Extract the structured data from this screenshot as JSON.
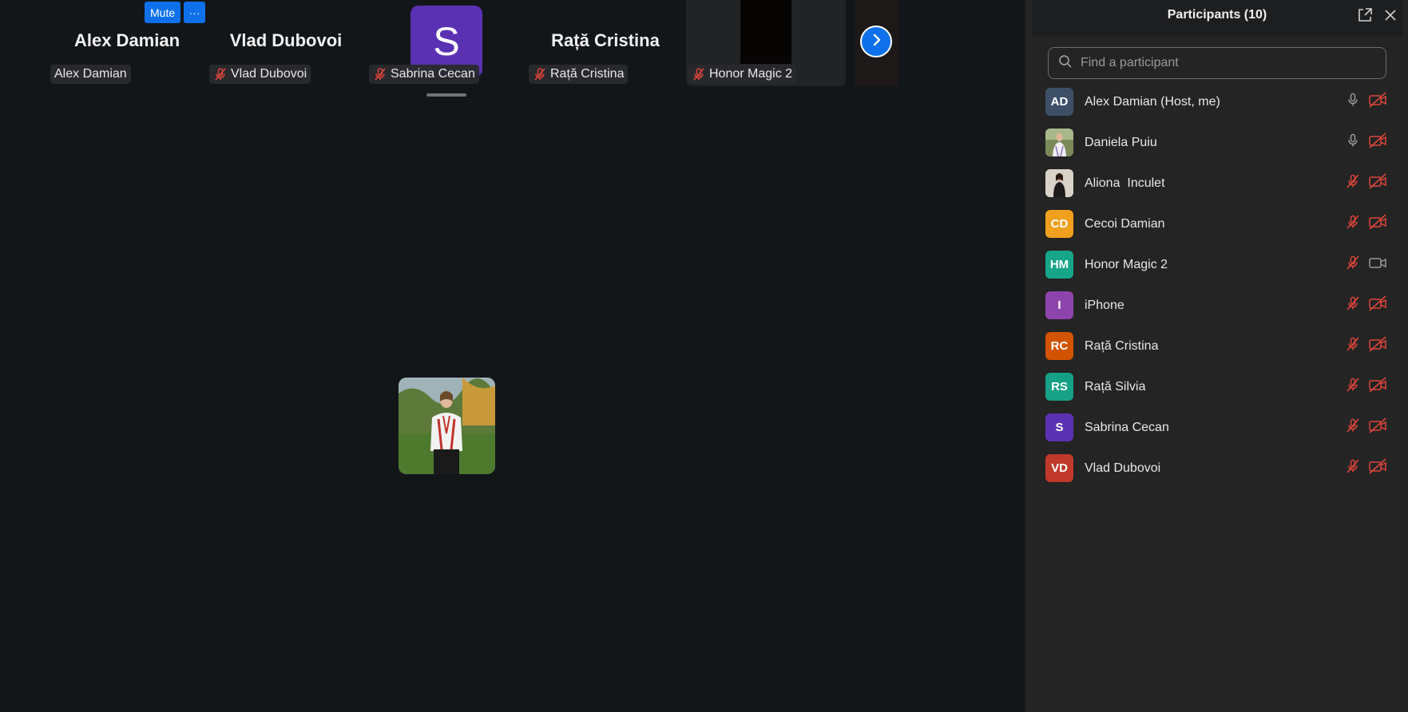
{
  "strip": {
    "tiles": [
      {
        "big_name": "Alex Damian",
        "label": "Alex Damian"
      },
      {
        "big_name": "Vlad Dubovoi",
        "label": "Vlad Dubovoi"
      },
      {
        "avatar_letter": "S",
        "label": "Sabrina Cecan"
      },
      {
        "big_name": "Rață Cristina",
        "label": "Rață Cristina"
      },
      {
        "label": "Honor Magic 2"
      }
    ],
    "mute_label": "Mute",
    "more_label": "···"
  },
  "panel": {
    "title": "Participants (10)",
    "search_placeholder": "Find a participant",
    "participants": [
      {
        "initials": "AD",
        "name": "Alex Damian (Host, me)",
        "color": "#3d5068",
        "mic": "on",
        "cam": "off"
      },
      {
        "initials": "",
        "name": "Daniela Puiu",
        "color": "#7c8a5a",
        "mic": "on",
        "cam": "off",
        "photo": true
      },
      {
        "initials": "",
        "name": "Aliona  Inculet",
        "color": "#d8d2c8",
        "mic": "off",
        "cam": "off",
        "photo": true
      },
      {
        "initials": "CD",
        "name": "Cecoi Damian",
        "color": "#f0a01e",
        "mic": "off",
        "cam": "off"
      },
      {
        "initials": "HM",
        "name": "Honor Magic 2",
        "color": "#17a589",
        "mic": "off",
        "cam": "on"
      },
      {
        "initials": "I",
        "name": "iPhone",
        "color": "#8e44ad",
        "mic": "off",
        "cam": "off"
      },
      {
        "initials": "RC",
        "name": "Rață Cristina",
        "color": "#d35400",
        "mic": "off",
        "cam": "off"
      },
      {
        "initials": "RS",
        "name": "Rață Silvia",
        "color": "#16a085",
        "mic": "off",
        "cam": "off"
      },
      {
        "initials": "S",
        "name": "Sabrina Cecan",
        "color": "#5b31b3",
        "mic": "off",
        "cam": "off"
      },
      {
        "initials": "VD",
        "name": "Vlad Dubovoi",
        "color": "#c0392b",
        "mic": "off",
        "cam": "off"
      }
    ]
  }
}
